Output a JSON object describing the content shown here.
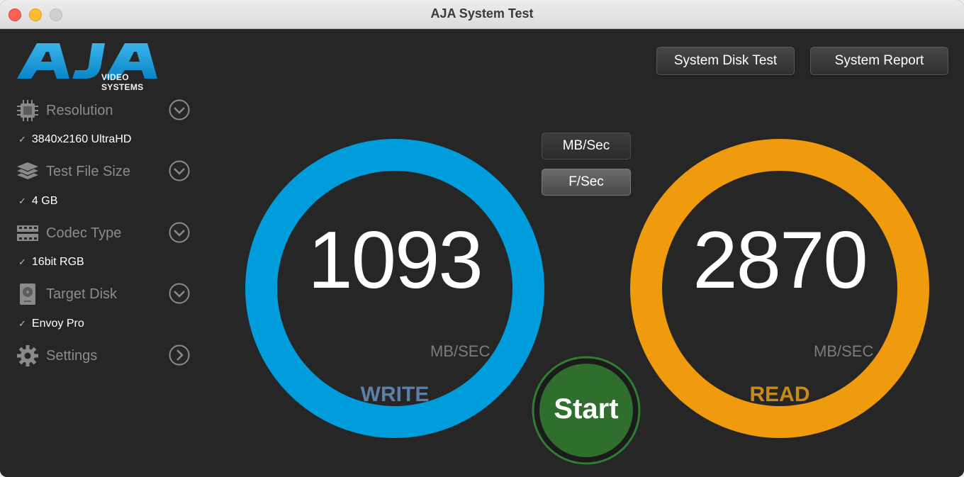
{
  "window": {
    "title": "AJA System Test"
  },
  "logo": {
    "brand": "AJA",
    "subtitle": "VIDEO SYSTEMS"
  },
  "sidebar": {
    "sections": [
      {
        "label": "Resolution",
        "icon": "chip-icon",
        "value": "3840x2160 UltraHD",
        "chevron": "chevron-down-icon"
      },
      {
        "label": "Test File Size",
        "icon": "layers-icon",
        "value": "4 GB",
        "chevron": "chevron-down-icon"
      },
      {
        "label": "Codec Type",
        "icon": "film-strip-icon",
        "value": "16bit RGB",
        "chevron": "chevron-down-icon"
      },
      {
        "label": "Target Disk",
        "icon": "hard-disk-icon",
        "value": "Envoy Pro",
        "chevron": "chevron-down-icon"
      },
      {
        "label": "Settings",
        "icon": "gear-icon",
        "chevron": "chevron-right-icon"
      }
    ],
    "check_mark": "✓"
  },
  "toolbar": {
    "system_disk_test": "System Disk Test",
    "system_report": "System Report"
  },
  "units": {
    "mb_sec": "MB/Sec",
    "f_sec": "F/Sec",
    "selected": "F/Sec"
  },
  "write": {
    "value": "1093",
    "unit": "MB/SEC",
    "label": "WRITE",
    "ring_color": "#009ddc",
    "label_color": "#5b7fa6"
  },
  "read": {
    "value": "2870",
    "unit": "MB/SEC",
    "label": "READ",
    "ring_color": "#f09a0e",
    "label_color": "#c98a16"
  },
  "start": {
    "label": "Start",
    "color": "#2f7d32"
  }
}
